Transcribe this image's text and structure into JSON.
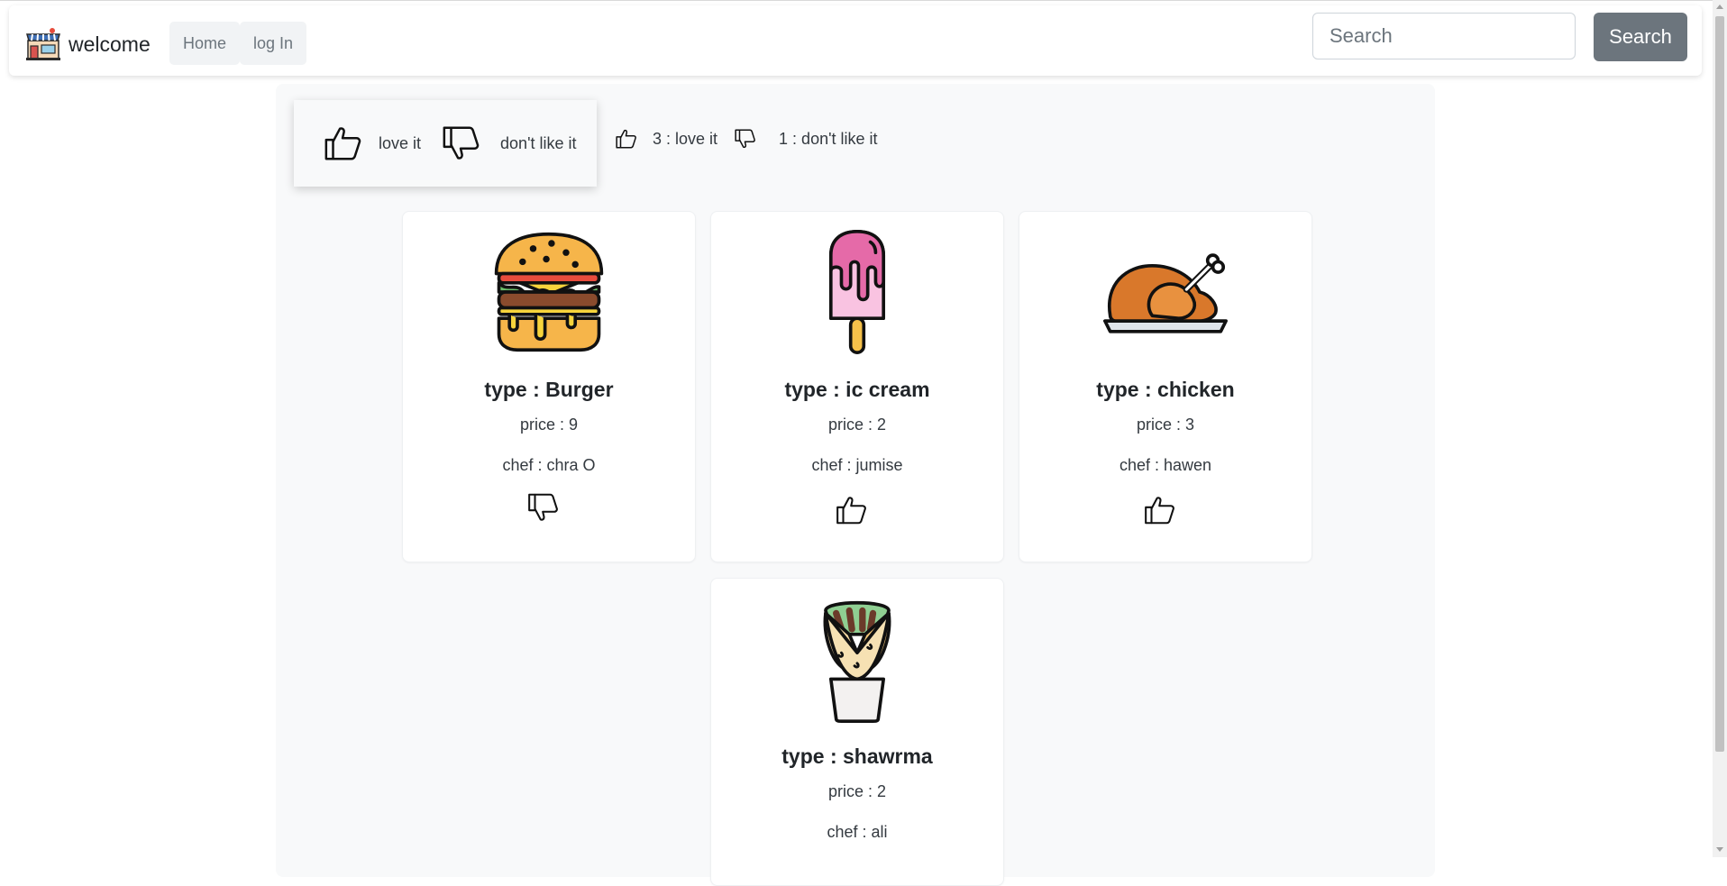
{
  "navbar": {
    "brand": "welcome",
    "links": [
      "Home",
      "log In"
    ],
    "search_placeholder": "Search",
    "search_button": "Search"
  },
  "legend": {
    "like_label": "love it",
    "dislike_label": "don't like it",
    "like_icon": "thumbs-up-icon",
    "dislike_icon": "thumbs-down-icon"
  },
  "stats": {
    "likes_text": "3 : love it",
    "dislikes_text": "1 : don't like it"
  },
  "foods": [
    {
      "title": "type : Burger",
      "price": "price : 9",
      "chef": "chef : chra O",
      "image": "burger-icon",
      "reaction": "thumbs-down-icon"
    },
    {
      "title": "type : ic cream",
      "price": "price : 2",
      "chef": "chef : jumise",
      "image": "popsicle-icon",
      "reaction": "thumbs-up-icon"
    },
    {
      "title": "type : chicken",
      "price": "price : 3",
      "chef": "chef : hawen",
      "image": "roast-chicken-icon",
      "reaction": "thumbs-up-icon"
    },
    {
      "title": "type : shawrma",
      "price": "price : 2",
      "chef": "chef : ali",
      "image": "shawarma-wrap-icon",
      "reaction": ""
    }
  ],
  "colors": {
    "container_bg": "#f8f9fa",
    "search_button_bg": "#6c757d",
    "nav_link_bg": "#f1f3f5"
  }
}
